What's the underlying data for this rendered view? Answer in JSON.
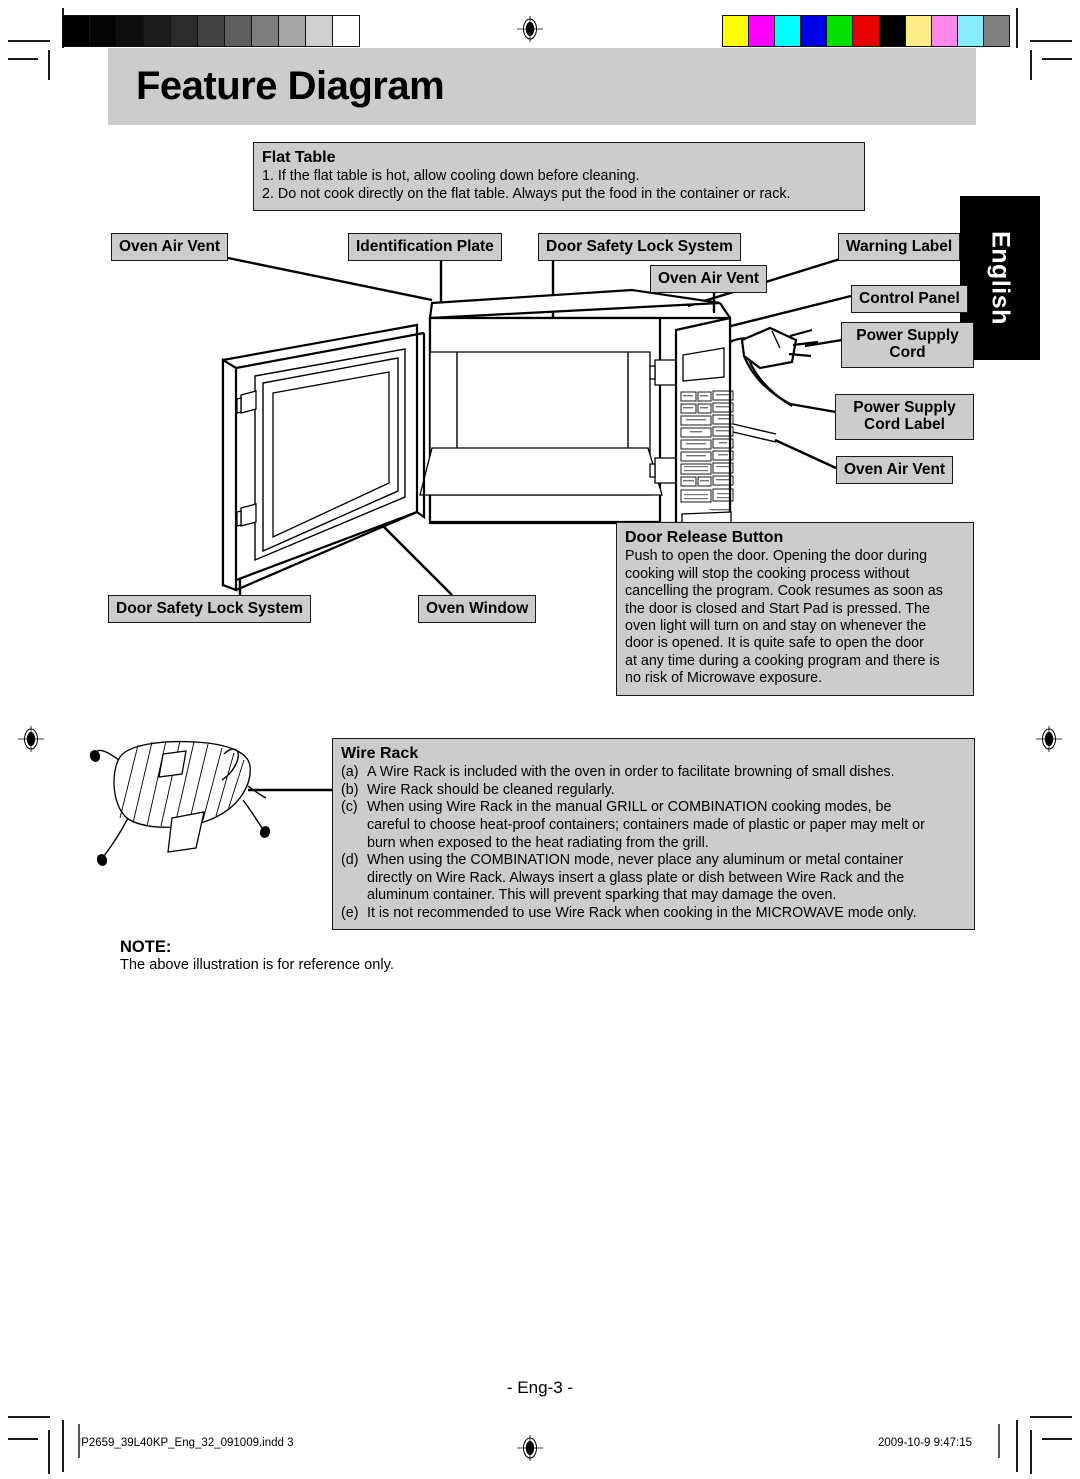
{
  "page": {
    "title": "Feature Diagram",
    "language_tab": "English",
    "page_number": "- Eng-3 -"
  },
  "flat_table": {
    "heading": "Flat Table",
    "lines": [
      "1. If the flat table is hot, allow cooling down before cleaning.",
      "2. Do not cook directly on the flat table. Always put the food in the container or rack."
    ]
  },
  "callouts": {
    "oven_air_vent_left": "Oven Air Vent",
    "identification_plate": "Identification Plate",
    "door_safety_lock_top": "Door Safety Lock System",
    "warning_label": "Warning Label",
    "oven_air_vent_mid": "Oven Air Vent",
    "control_panel": "Control Panel",
    "power_supply_cord": "Power Supply Cord",
    "power_supply_cord_label": "Power Supply Cord Label",
    "oven_air_vent_right": "Oven Air Vent",
    "door_safety_lock_bottom": "Door Safety Lock System",
    "oven_window": "Oven Window"
  },
  "door_release": {
    "heading": "Door Release Button",
    "lines": [
      "Push to open the door. Opening the door during",
      "cooking will stop the cooking process without",
      "cancelling the program. Cook resumes as soon as",
      "the door is closed and Start Pad is pressed. The",
      "oven light will turn on and stay on whenever the",
      "door is opened. It is quite safe to open the door",
      "at any time during a cooking program and there is",
      "no risk of Microwave exposure."
    ]
  },
  "wire_rack": {
    "heading": "Wire Rack",
    "items": [
      {
        "mark": "(a)",
        "lines": [
          "A Wire Rack is included with the oven in order to facilitate browning of small dishes."
        ]
      },
      {
        "mark": "(b)",
        "lines": [
          "Wire Rack should be cleaned regularly."
        ]
      },
      {
        "mark": "(c)",
        "lines": [
          "When using Wire Rack in the manual GRILL or COMBINATION cooking modes, be",
          "careful to choose heat-proof containers; containers made of plastic or paper may melt or",
          "burn when exposed to the heat radiating from the grill."
        ]
      },
      {
        "mark": "(d)",
        "lines": [
          "When using the COMBINATION mode, never place any aluminum or metal container",
          "directly on Wire Rack. Always insert a glass plate or dish between Wire Rack and the",
          "aluminum container. This will prevent sparking that may damage the oven."
        ]
      },
      {
        "mark": "(e)",
        "lines": [
          "It is not recommended to use Wire Rack when cooking in the MICROWAVE mode only."
        ]
      }
    ]
  },
  "note": {
    "heading": "NOTE:",
    "body": "The above illustration is for reference only."
  },
  "footer": {
    "file_name": "IP2659_39L40KP_Eng_32_091009.indd   3",
    "timestamp": "2009-10-9   9:47:15"
  },
  "print_bars": {
    "grayscale": [
      "#000000",
      "#050505",
      "#0d0d0d",
      "#1c1c1c",
      "#2b2b2b",
      "#434343",
      "#5e5e5e",
      "#7e7e7e",
      "#a5a5a5",
      "#d0d0d0",
      "#ffffff"
    ],
    "color": [
      "#ffff00",
      "#ff00ff",
      "#00ffff",
      "#0000e6",
      "#00e000",
      "#e60000",
      "#000000",
      "#ffee88",
      "#ff88ee",
      "#88eeff",
      "#808080"
    ]
  },
  "theme": {
    "chip_fill": "#cccccc",
    "chip_border": "#1a1a1a",
    "title_band": "#cccccc",
    "tab_bg": "#000000",
    "tab_fg": "#ffffff"
  }
}
